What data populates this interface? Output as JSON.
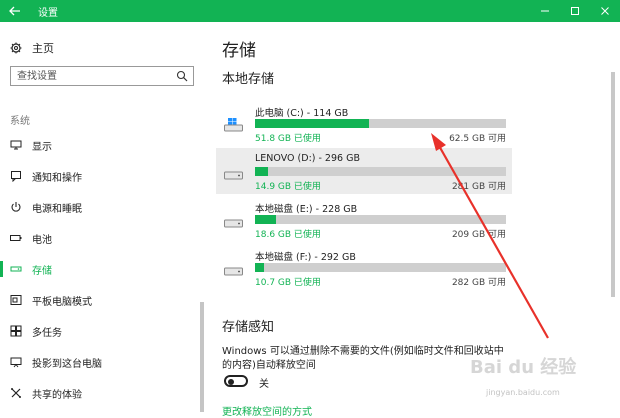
{
  "window": {
    "title": "设置"
  },
  "sidebar": {
    "home_label": "主页",
    "search_placeholder": "查找设置",
    "category": "系统",
    "items": [
      {
        "label": "显示"
      },
      {
        "label": "通知和操作"
      },
      {
        "label": "电源和睡眠"
      },
      {
        "label": "电池"
      },
      {
        "label": "存储",
        "active": true
      },
      {
        "label": "平板电脑模式"
      },
      {
        "label": "多任务"
      },
      {
        "label": "投影到这台电脑"
      },
      {
        "label": "共享的体验"
      }
    ]
  },
  "main": {
    "page_title": "存储",
    "local_storage_heading": "本地存储",
    "drives": [
      {
        "name": "此电脑 (C:) - 114 GB",
        "used": "51.8 GB 已使用",
        "free": "62.5 GB 可用",
        "used_fraction": 0.454,
        "icon": "windows-drive-icon"
      },
      {
        "name": "LENOVO (D:) - 296 GB",
        "used": "14.9 GB 已使用",
        "free": "281 GB 可用",
        "used_fraction": 0.05,
        "icon": "drive-icon"
      },
      {
        "name": "本地磁盘 (E:) - 228 GB",
        "used": "18.6 GB 已使用",
        "free": "209 GB 可用",
        "used_fraction": 0.082,
        "icon": "drive-icon"
      },
      {
        "name": "本地磁盘 (F:) - 292 GB",
        "used": "10.7 GB 已使用",
        "free": "282 GB 可用",
        "used_fraction": 0.037,
        "icon": "drive-icon"
      }
    ],
    "storage_sense_heading": "存储感知",
    "storage_sense_desc": "Windows 可以通过删除不需要的文件(例如临时文件和回收站中的内容)自动释放空间",
    "toggle_label": "关",
    "toggle_on": false,
    "link": "更改释放空间的方式"
  },
  "watermark": {
    "text": "Bai du 经验",
    "sub": "jingyan.baidu.com"
  },
  "colors": {
    "accent": "#12b354",
    "annotation": "#e8312a"
  }
}
